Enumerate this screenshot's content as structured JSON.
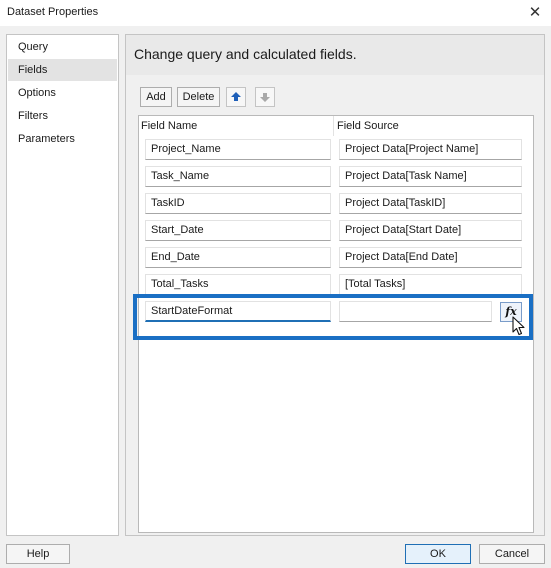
{
  "window": {
    "title": "Dataset Properties",
    "close_glyph": "✕"
  },
  "nav": {
    "items": [
      {
        "label": "Query"
      },
      {
        "label": "Fields",
        "selected": true
      },
      {
        "label": "Options"
      },
      {
        "label": "Filters"
      },
      {
        "label": "Parameters"
      }
    ]
  },
  "main": {
    "header": "Change query and calculated fields.",
    "toolbar": {
      "add_label": "Add",
      "delete_label": "Delete",
      "move_up_icon": "arrow-up-icon",
      "move_down_icon": "arrow-down-icon"
    },
    "table": {
      "columns": [
        "Field Name",
        "Field Source"
      ],
      "rows": [
        {
          "name": "Project_Name",
          "source": "Project Data[Project Name]"
        },
        {
          "name": "Task_Name",
          "source": "Project Data[Task Name]"
        },
        {
          "name": "TaskID",
          "source": "Project Data[TaskID]"
        },
        {
          "name": "Start_Date",
          "source": "Project Data[Start Date]"
        },
        {
          "name": "End_Date",
          "source": "Project Data[End Date]"
        },
        {
          "name": "Total_Tasks",
          "source": "[Total Tasks]"
        },
        {
          "name": "StartDateFormat",
          "source": ""
        }
      ],
      "fx_label": "fx"
    }
  },
  "footer": {
    "help_label": "Help",
    "ok_label": "OK",
    "cancel_label": "Cancel"
  },
  "colors": {
    "accent": "#1a6fc4",
    "highlight_border": "#1a6fc4"
  }
}
